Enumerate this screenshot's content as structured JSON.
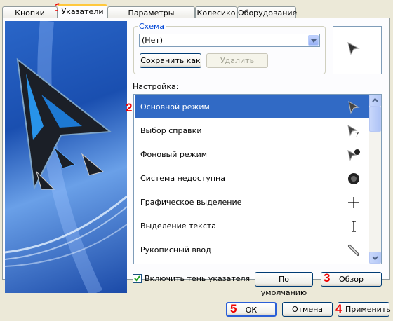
{
  "tabs": [
    {
      "label": "Кнопки мыши"
    },
    {
      "label": "Указатели"
    },
    {
      "label": "Параметры указателя"
    },
    {
      "label": "Колесико"
    },
    {
      "label": "Оборудование"
    }
  ],
  "scheme": {
    "legend": "Схема",
    "value": "(Нет)",
    "save_label": "Сохранить как",
    "delete_label": "Удалить"
  },
  "settings_label": "Настройка:",
  "cursor_list": [
    {
      "label": "Основной режим",
      "icon": "arrow-cursor-icon",
      "selected": true
    },
    {
      "label": "Выбор справки",
      "icon": "help-cursor-icon"
    },
    {
      "label": "Фоновый режим",
      "icon": "working-in-background-cursor-icon"
    },
    {
      "label": "Система недоступна",
      "icon": "busy-cursor-icon"
    },
    {
      "label": "Графическое выделение",
      "icon": "precision-select-cursor-icon"
    },
    {
      "label": "Выделение текста",
      "icon": "text-select-cursor-icon"
    },
    {
      "label": "Рукописный ввод",
      "icon": "handwriting-cursor-icon"
    }
  ],
  "shadow": {
    "label": "Включить тень указателя",
    "checked": true
  },
  "default_label": "По умолчанию",
  "browse_label": "Обзор",
  "footer": {
    "ok": "ОК",
    "cancel": "Отмена",
    "apply": "Применить"
  },
  "markers": {
    "m1": "1",
    "m2": "2",
    "m3": "3",
    "m4": "4",
    "m5": "5"
  },
  "colors": {
    "selection": "#316ac5",
    "marker": "#e00000",
    "tab_highlight": "#ffc83c"
  }
}
